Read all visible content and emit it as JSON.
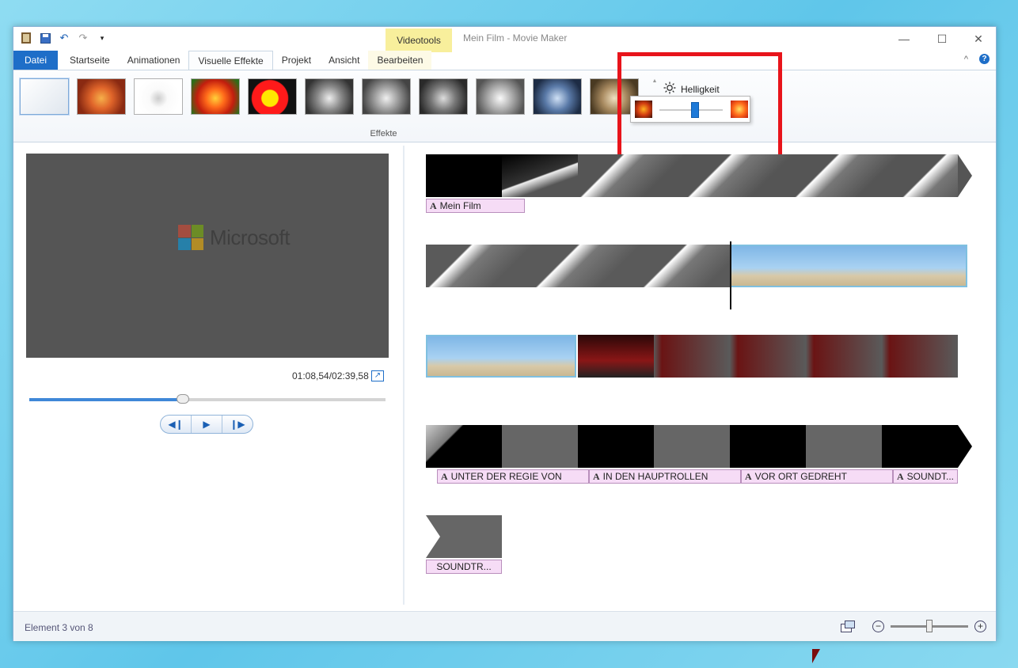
{
  "window": {
    "title": "Mein Film - Movie Maker",
    "context_tab": "Videotools",
    "controls": {
      "minimize": "—",
      "maximize": "☐",
      "close": "✕"
    }
  },
  "tabs": [
    {
      "label": "Datei"
    },
    {
      "label": "Startseite"
    },
    {
      "label": "Animationen"
    },
    {
      "label": "Visuelle Effekte"
    },
    {
      "label": "Projekt"
    },
    {
      "label": "Ansicht"
    },
    {
      "label": "Bearbeiten"
    }
  ],
  "ribbon": {
    "group_label": "Effekte",
    "brightness_label": "Helligkeit",
    "brightness_level": 0.5,
    "help": "?",
    "collapse": "^"
  },
  "preview": {
    "logo_text": "Microsoft",
    "timecode": "01:08,54/02:39,58",
    "seek_position": 0.43
  },
  "storyboard": {
    "captions": {
      "row1": "Mein Film",
      "row4_a": "UNTER DER REGIE VON",
      "row4_b": "IN DEN HAUPTROLLEN",
      "row4_c": "VOR ORT GEDREHT",
      "row4_d": "SOUNDT...",
      "row5": "SOUNDTR..."
    },
    "caption_icon": "A"
  },
  "status": {
    "text": "Element 3 von 8",
    "zoom_level": 0.5
  },
  "colors": {
    "accent": "#1e6ec8",
    "highlight_box": "#e8141b",
    "caption_bg": "#f6dcf6",
    "context_tab": "#f8ef9c"
  }
}
